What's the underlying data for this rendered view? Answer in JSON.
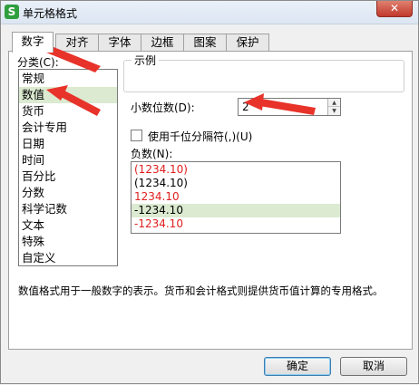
{
  "window": {
    "title": "单元格格式",
    "app_icon": "S",
    "close_glyph": "✕"
  },
  "tabs": [
    {
      "label": "数字",
      "active": true
    },
    {
      "label": "对齐",
      "active": false
    },
    {
      "label": "字体",
      "active": false
    },
    {
      "label": "边框",
      "active": false
    },
    {
      "label": "图案",
      "active": false
    },
    {
      "label": "保护",
      "active": false
    }
  ],
  "category": {
    "label": "分类(C):",
    "items": [
      "常规",
      "数值",
      "货币",
      "会计专用",
      "日期",
      "时间",
      "百分比",
      "分数",
      "科学记数",
      "文本",
      "特殊",
      "自定义"
    ],
    "selected": "数值"
  },
  "sample": {
    "legend": "示例",
    "value": ""
  },
  "decimal_places": {
    "label": "小数位数(D):",
    "value": "2"
  },
  "thousands_separator": {
    "label": "使用千位分隔符(,)(U)",
    "checked": false
  },
  "negative_numbers": {
    "label": "负数(N):",
    "items": [
      {
        "text": "(1234.10)",
        "color": "#e02020"
      },
      {
        "text": "(1234.10)",
        "color": "#000000"
      },
      {
        "text": "1234.10",
        "color": "#e02020"
      },
      {
        "text": "-1234.10",
        "color": "#000000"
      },
      {
        "text": "-1234.10",
        "color": "#e02020"
      }
    ],
    "selected_index": 3
  },
  "description": "数值格式用于一般数字的表示。货币和会计格式则提供货币值计算的专用格式。",
  "buttons": {
    "ok": "确定",
    "cancel": "取消"
  },
  "colors": {
    "selection_bg": "#dbead0",
    "negative_red": "#e02020",
    "annotation_arrow": "#e8332a"
  }
}
